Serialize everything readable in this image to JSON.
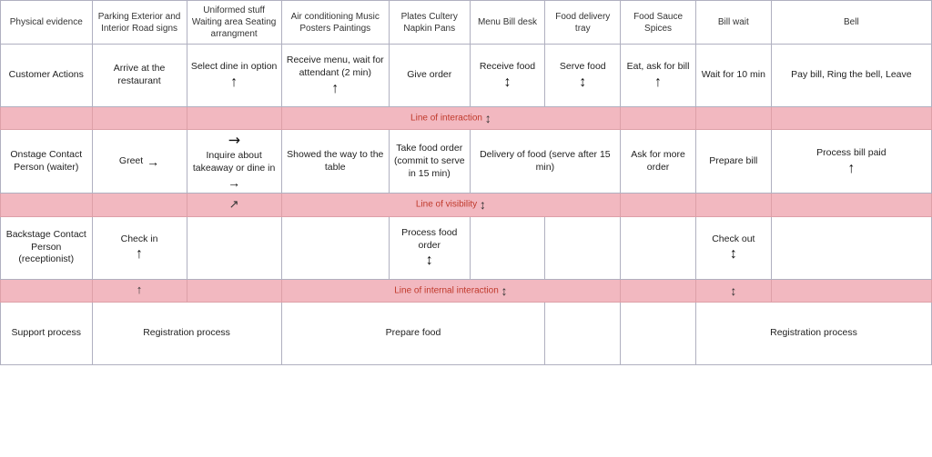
{
  "header": {
    "cols": [
      "Physical evidence",
      "Parking Exterior and Interior Road signs",
      "Uniformed stuff Waiting area Seating arrangment",
      "Air conditioning Music Posters Paintings",
      "Plates Cultery Napkin Pans",
      "Menu Bill desk",
      "Food delivery tray",
      "Food Sauce Spices",
      "Bill wait",
      "Bell"
    ]
  },
  "rows": {
    "customer": {
      "label": "Customer Actions",
      "cells": [
        "Arrive at the restaurant",
        "Select dine in option",
        "Receive menu, wait for attendant (2 min)",
        "Give order",
        "Receive food",
        "Serve food",
        "Eat, ask for bill",
        "Wait for 10 min",
        "Pay bill, Ring the bell, Leave"
      ]
    },
    "line_interaction": "Line of interaction",
    "onstage": {
      "label": "Onstage Contact Person (waiter)",
      "cells": [
        "Greet",
        "Inquire about takeaway or dine in",
        "Showed the way to the table",
        "Take food order (commit to serve in 15 min)",
        "Delivery of food (serve after 15 min)",
        "",
        "Ask for more order",
        "Prepare bill",
        "Process bill paid"
      ]
    },
    "line_visibility": "Line of visibility",
    "backstage": {
      "label": "Backstage Contact Person (receptionist)",
      "cells": [
        "Check in",
        "",
        "",
        "Process food order",
        "",
        "",
        "",
        "Check out",
        ""
      ]
    },
    "line_internal": "Line of internal interaction",
    "support": {
      "label": "Support process",
      "cells": [
        "Registration process",
        "",
        "Prepare food",
        "",
        "",
        "",
        "",
        "Registration process",
        ""
      ]
    }
  },
  "arrows": {
    "up": "↑",
    "down": "↓",
    "updown": "↕",
    "right": "→",
    "diagonal_up": "↗"
  }
}
